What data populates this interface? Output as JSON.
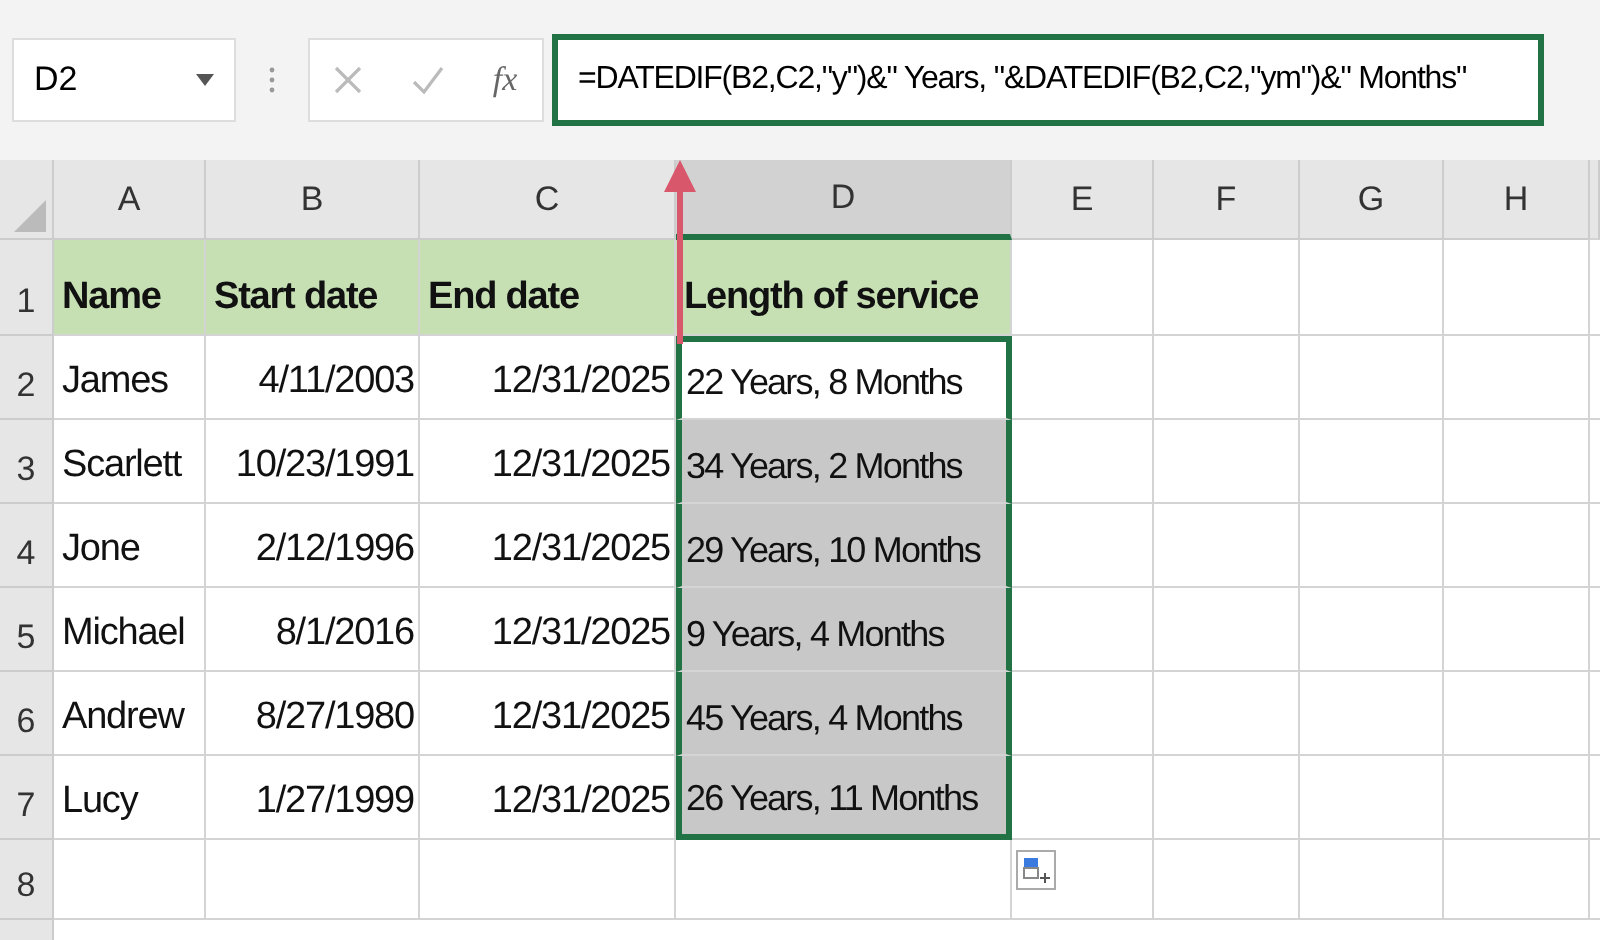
{
  "name_box": {
    "value": "D2"
  },
  "formula_bar": {
    "fx_label": "fx",
    "formula": "=DATEDIF(B2,C2,\"y\")&\" Years, \"&DATEDIF(B2,C2,\"ym\")&\" Months\""
  },
  "columns": [
    {
      "label": "A",
      "selected": false
    },
    {
      "label": "B",
      "selected": false
    },
    {
      "label": "C",
      "selected": false
    },
    {
      "label": "D",
      "selected": true
    },
    {
      "label": "E",
      "selected": false
    },
    {
      "label": "F",
      "selected": false
    },
    {
      "label": "G",
      "selected": false
    },
    {
      "label": "H",
      "selected": false
    }
  ],
  "header_row": {
    "number": "1",
    "cells": [
      "Name",
      "Start date",
      "End date",
      "Length of service"
    ]
  },
  "rows": [
    {
      "number": "2",
      "name": "James",
      "start": "4/11/2003",
      "end": "12/31/2025",
      "service": "22 Years, 8 Months",
      "selected": false
    },
    {
      "number": "3",
      "name": "Scarlett",
      "start": "10/23/1991",
      "end": "12/31/2025",
      "service": "34 Years, 2 Months",
      "selected": true
    },
    {
      "number": "4",
      "name": "Jone",
      "start": "2/12/1996",
      "end": "12/31/2025",
      "service": "29 Years, 10 Months",
      "selected": true
    },
    {
      "number": "5",
      "name": "Michael",
      "start": "8/1/2016",
      "end": "12/31/2025",
      "service": "9 Years, 4 Months",
      "selected": true
    },
    {
      "number": "6",
      "name": "Andrew",
      "start": "8/27/1980",
      "end": "12/31/2025",
      "service": "45 Years, 4 Months",
      "selected": true
    },
    {
      "number": "7",
      "name": "Lucy",
      "start": "1/27/1999",
      "end": "12/31/2025",
      "service": "26 Years, 11 Months",
      "selected": true
    }
  ],
  "empty_rows": [
    "8"
  ]
}
